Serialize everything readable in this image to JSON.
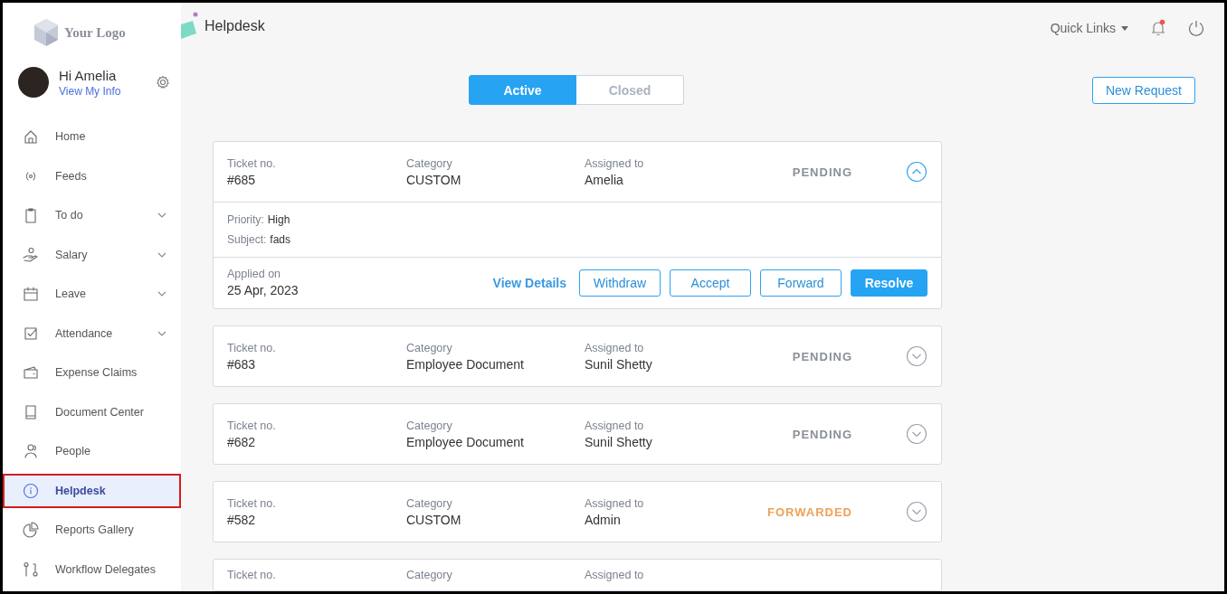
{
  "sidebar": {
    "logo": "Your Logo",
    "user": {
      "greeting": "Hi Amelia",
      "link": "View My Info"
    },
    "items": [
      {
        "label": "Home",
        "expandable": false,
        "selected": false
      },
      {
        "label": "Feeds",
        "expandable": false,
        "selected": false
      },
      {
        "label": "To do",
        "expandable": true,
        "selected": false
      },
      {
        "label": "Salary",
        "expandable": true,
        "selected": false
      },
      {
        "label": "Leave",
        "expandable": true,
        "selected": false
      },
      {
        "label": "Attendance",
        "expandable": true,
        "selected": false
      },
      {
        "label": "Expense Claims",
        "expandable": false,
        "selected": false
      },
      {
        "label": "Document Center",
        "expandable": false,
        "selected": false
      },
      {
        "label": "People",
        "expandable": false,
        "selected": false
      },
      {
        "label": "Helpdesk",
        "expandable": false,
        "selected": true
      },
      {
        "label": "Reports Gallery",
        "expandable": false,
        "selected": false
      },
      {
        "label": "Workflow Delegates",
        "expandable": false,
        "selected": false
      }
    ]
  },
  "header": {
    "title": "Helpdesk",
    "quick_links": "Quick Links",
    "notification": true
  },
  "tabs": [
    {
      "label": "Active",
      "selected": true
    },
    {
      "label": "Closed",
      "selected": false
    }
  ],
  "new_request": "New Request",
  "tickets": [
    {
      "ticket_label": "Ticket no.",
      "ticket": "#685",
      "category_label": "Category",
      "category": "CUSTOM",
      "assigned_label": "Assigned to",
      "assigned": "Amelia",
      "status": "PENDING",
      "color": "#8a8f98",
      "expanded": true,
      "details": [
        {
          "label": "Priority:",
          "value": "High"
        },
        {
          "label": "Subject:",
          "value": "fads"
        }
      ],
      "applied_label": "Applied on",
      "applied": "25 Apr, 2023",
      "link": "View Details",
      "actions": [
        {
          "label": "Withdraw",
          "kind": "outline"
        },
        {
          "label": "Accept",
          "kind": "outline"
        },
        {
          "label": "Forward",
          "kind": "outline"
        },
        {
          "label": "Resolve",
          "kind": "primary"
        }
      ]
    },
    {
      "ticket_label": "Ticket no.",
      "ticket": "#683",
      "category_label": "Category",
      "category": "Employee Document",
      "assigned_label": "Assigned to",
      "assigned": "Sunil Shetty",
      "status": "PENDING",
      "color": "#8a8f98",
      "expanded": false
    },
    {
      "ticket_label": "Ticket no.",
      "ticket": "#682",
      "category_label": "Category",
      "category": "Employee Document",
      "assigned_label": "Assigned to",
      "assigned": "Sunil Shetty",
      "status": "PENDING",
      "color": "#8a8f98",
      "expanded": false
    },
    {
      "ticket_label": "Ticket no.",
      "ticket": "#582",
      "category_label": "Category",
      "category": "CUSTOM",
      "assigned_label": "Assigned to",
      "assigned": "Admin",
      "status": "FORWARDED",
      "color": "#f0a05a",
      "expanded": false
    },
    {
      "ticket_label": "Ticket no.",
      "category_label": "Category",
      "assigned_label": "Assigned to"
    }
  ]
}
